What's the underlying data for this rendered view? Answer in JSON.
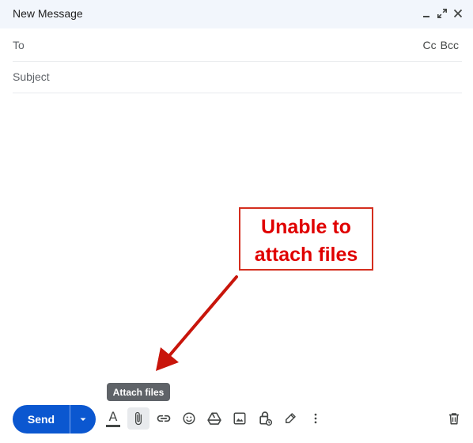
{
  "window": {
    "title": "New Message",
    "controls": [
      "minimize-icon",
      "expand-icon",
      "close-icon"
    ]
  },
  "fields": {
    "to_label": "To",
    "cc_label": "Cc",
    "bcc_label": "Bcc",
    "subject_placeholder": "Subject"
  },
  "annotation": {
    "line1": "Unable to",
    "line2": "attach files",
    "color": "#e00000"
  },
  "tooltip": {
    "text": "Attach files"
  },
  "toolbar": {
    "send_label": "Send",
    "format_glyph": "A",
    "icons": [
      "formatting-options-icon",
      "attach-file-icon",
      "insert-link-icon",
      "emoji-icon",
      "google-drive-icon",
      "insert-photo-icon",
      "confidential-mode-icon",
      "signature-icon",
      "more-options-icon",
      "discard-draft-icon"
    ]
  },
  "colors": {
    "accent": "#0b57d0",
    "header_bg": "#f2f6fc",
    "annotation_red": "#d42e1e"
  }
}
